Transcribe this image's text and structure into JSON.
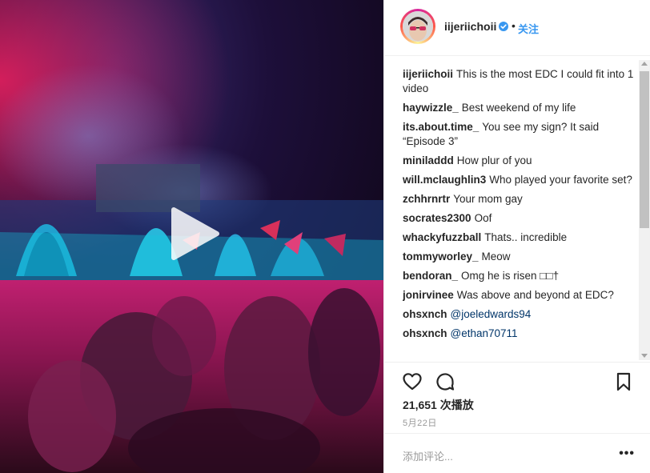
{
  "post": {
    "username": "iijeriichoii",
    "follow_label": "关注",
    "separator": "•",
    "verified": true,
    "views": "21,651 次播放",
    "date": "5月22日",
    "add_comment_placeholder": "添加评论...",
    "more_label": "•••"
  },
  "comments": [
    {
      "user": "iijeriichoii",
      "text": "This is the most EDC I could fit into 1 video"
    },
    {
      "user": "haywizzle_",
      "text": "Best weekend of my life"
    },
    {
      "user": "its.about.time_",
      "text": "You see my sign? It said “Episode 3”"
    },
    {
      "user": "miniladdd",
      "text": "How plur of you"
    },
    {
      "user": "will.mclaughlin3",
      "text": "Who played your favorite set?"
    },
    {
      "user": "zchhrnrtr",
      "text": "Your mom gay"
    },
    {
      "user": "socrates2300",
      "text": "Oof"
    },
    {
      "user": "whackyfuzzball",
      "text": "Thats.. incredible"
    },
    {
      "user": "tommyworley_",
      "text": "Meow"
    },
    {
      "user": "bendoran_",
      "text": "Omg he is risen □□†"
    },
    {
      "user": "jonirvinee",
      "text": "Was above and beyond at EDC?"
    },
    {
      "user": "ohsxnch",
      "mention": "@joeledwards94"
    },
    {
      "user": "ohsxnch",
      "mention": "@ethan70711"
    }
  ],
  "icons": {
    "play": "play-icon",
    "like": "heart-icon",
    "comment": "comment-icon",
    "save": "bookmark-icon",
    "verified": "verified-badge-icon"
  },
  "colors": {
    "accent": "#3897f0",
    "mention": "#003569",
    "muted": "#999999"
  }
}
